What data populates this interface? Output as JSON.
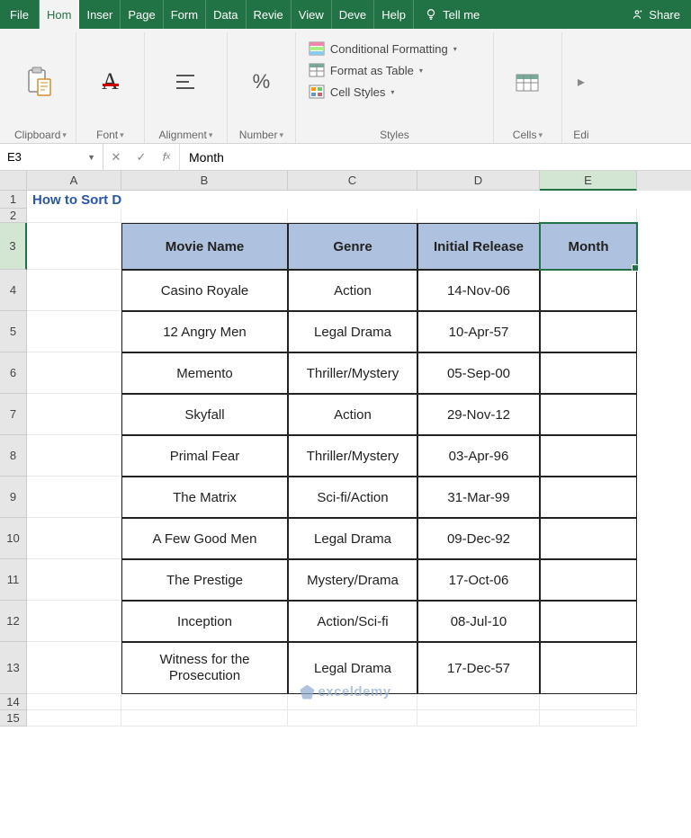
{
  "tabs": [
    "File",
    "Hom",
    "Inser",
    "Page",
    "Form",
    "Data",
    "Revie",
    "View",
    "Deve",
    "Help"
  ],
  "active_tab_index": 1,
  "tellme": "Tell me",
  "share": "Share",
  "ribbon": {
    "clipboard": "Clipboard",
    "font": "Font",
    "alignment": "Alignment",
    "number": "Number",
    "styles": "Styles",
    "cells": "Cells",
    "editing": "Edi",
    "cond_fmt": "Conditional Formatting",
    "fmt_table": "Format as Table",
    "cell_styles": "Cell Styles"
  },
  "name_box": "E3",
  "formula_value": "Month",
  "columns": [
    "A",
    "B",
    "C",
    "D",
    "E"
  ],
  "selected_col": "E",
  "selected_row": 3,
  "title": "How to Sort Dates in Excel by Month",
  "headers": [
    "Movie Name",
    "Genre",
    "Initial Release",
    "Month"
  ],
  "rows": [
    {
      "name": "Casino Royale",
      "genre": "Action",
      "release": "14-Nov-06",
      "month": ""
    },
    {
      "name": "12 Angry Men",
      "genre": "Legal Drama",
      "release": "10-Apr-57",
      "month": ""
    },
    {
      "name": "Memento",
      "genre": "Thriller/Mystery",
      "release": "05-Sep-00",
      "month": ""
    },
    {
      "name": "Skyfall",
      "genre": "Action",
      "release": "29-Nov-12",
      "month": ""
    },
    {
      "name": "Primal Fear",
      "genre": "Thriller/Mystery",
      "release": "03-Apr-96",
      "month": ""
    },
    {
      "name": "The Matrix",
      "genre": "Sci-fi/Action",
      "release": "31-Mar-99",
      "month": ""
    },
    {
      "name": "A Few Good Men",
      "genre": "Legal Drama",
      "release": "09-Dec-92",
      "month": ""
    },
    {
      "name": "The Prestige",
      "genre": "Mystery/Drama",
      "release": "17-Oct-06",
      "month": ""
    },
    {
      "name": "Inception",
      "genre": "Action/Sci-fi",
      "release": "08-Jul-10",
      "month": ""
    },
    {
      "name": "Witness for the Prosecution",
      "genre": "Legal Drama",
      "release": "17-Dec-57",
      "month": ""
    }
  ],
  "watermark": "exceldemy"
}
